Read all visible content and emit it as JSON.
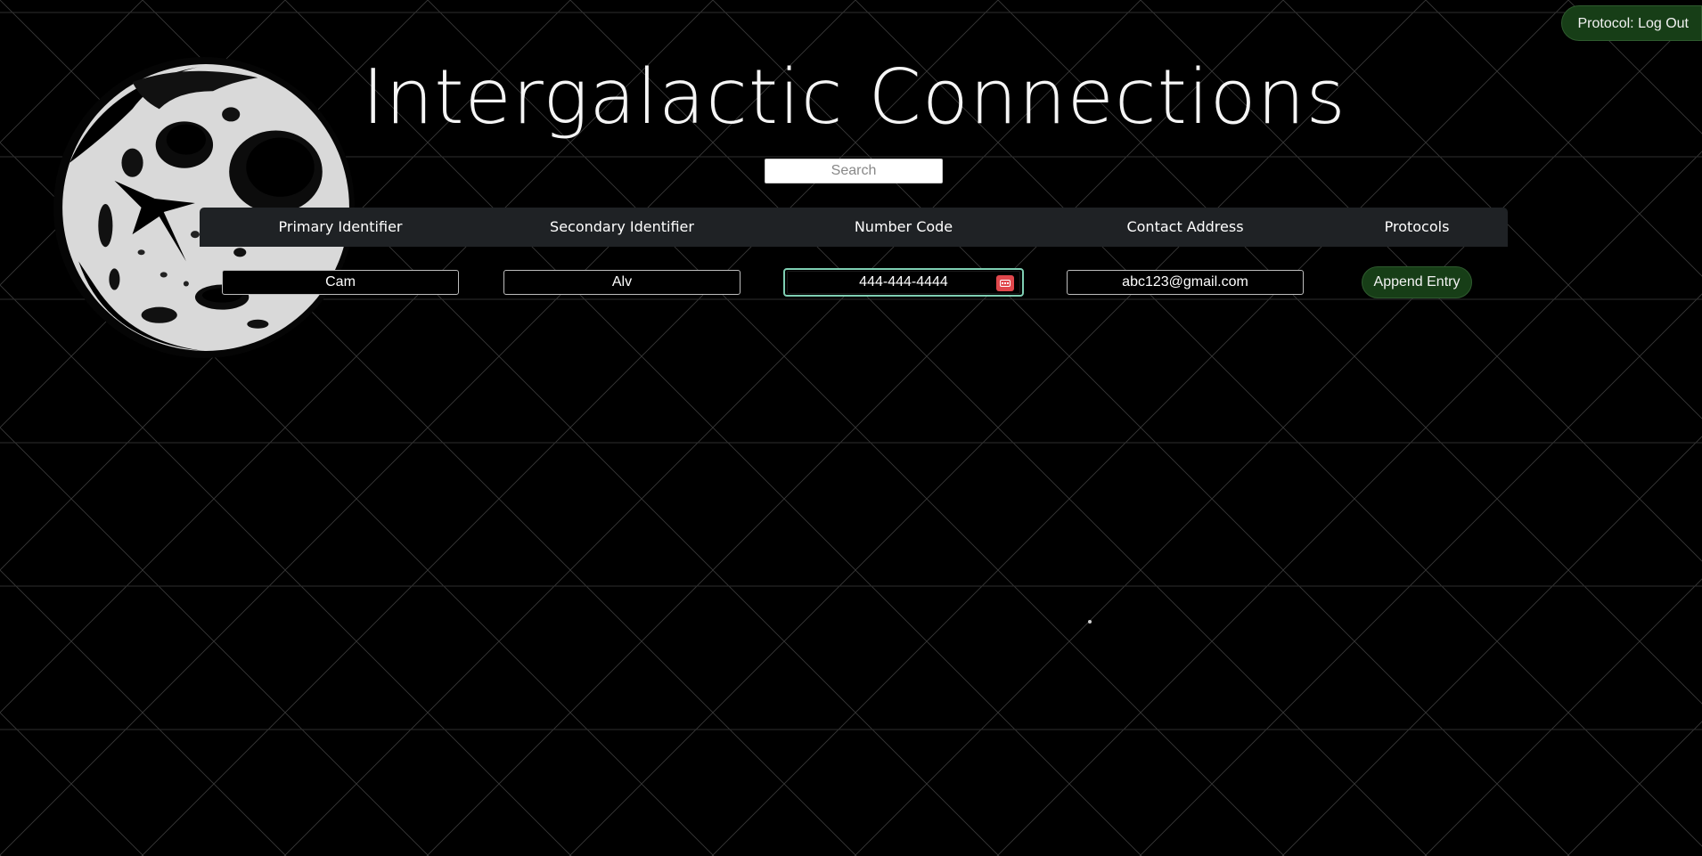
{
  "app": {
    "title": "Intergalactic Connections",
    "logout_label": "Protocol: Log Out"
  },
  "search": {
    "placeholder": "Search",
    "value": ""
  },
  "table": {
    "headers": [
      "Primary Identifier",
      "Secondary Identifier",
      "Number Code",
      "Contact Address",
      "Protocols"
    ],
    "entry": {
      "primary": "Cam",
      "secondary": "Alv",
      "number": "444-444-4444",
      "email": "abc123@gmail.com",
      "append_label": "Append Entry"
    }
  },
  "icons": {
    "logo": "moon-logo-icon",
    "autofill": "password-manager-autofill-icon"
  },
  "colors": {
    "background": "#000000",
    "header_bg": "#1f2225",
    "button_bg": "#173e17",
    "focus_ring": "#7fcfb3",
    "autofill_icon": "#e0474c"
  }
}
